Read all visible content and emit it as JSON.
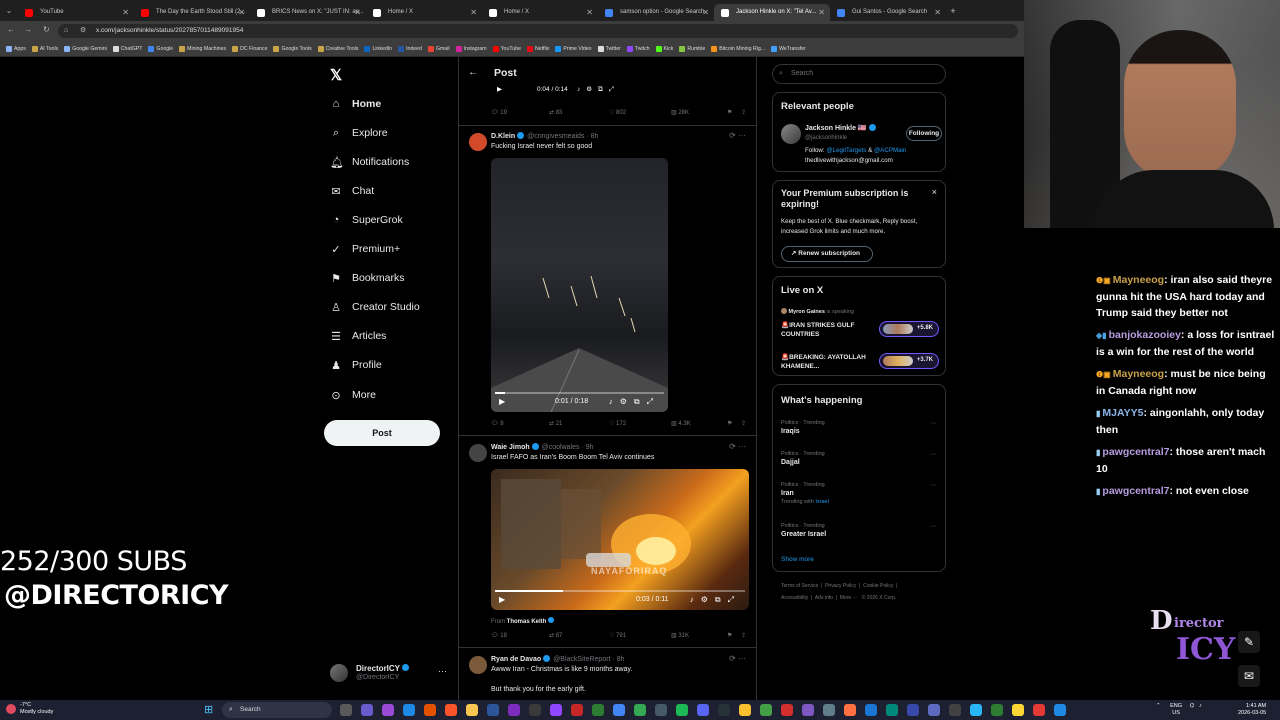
{
  "browser": {
    "tabs": [
      {
        "label": "YouTube",
        "color": "#ff0000"
      },
      {
        "label": "The Day the Earth Stood Still (2...",
        "color": "#ff0000"
      },
      {
        "label": "BRICS News on X: \"JUST IN: ac...",
        "color": "#ffffff"
      },
      {
        "label": "Home / X",
        "color": "#ffffff"
      },
      {
        "label": "Home / X",
        "color": "#ffffff"
      },
      {
        "label": "samson option - Google Search",
        "color": "#4285f4"
      },
      {
        "label": "Jackson Hinkle on X: \"Tel Av...",
        "color": "#ffffff",
        "active": true
      },
      {
        "label": "Gui Santos - Google Search",
        "color": "#4285f4"
      }
    ],
    "url": "x.com/jacksonhinkle/status/2027857011489091954",
    "bookmarks": [
      "Apps",
      "AI Tools",
      "Google Gemini",
      "ChatGPT",
      "Google",
      "Mining Machines",
      "DC Finance",
      "Google Tools",
      "Creative Tools",
      "LinkedIn",
      "Indeed",
      "Gmail",
      "Instagram",
      "YouTube",
      "Netflix",
      "Prime Video",
      "Twitter",
      "Twitch",
      "Kick",
      "Rumble",
      "Bitcoin Mining Rig...",
      "WeTransfer"
    ]
  },
  "nav": {
    "logo": "𝕏",
    "items": [
      {
        "label": "Home",
        "icon": "⌂",
        "name": "home-icon"
      },
      {
        "label": "Explore",
        "icon": "⌕",
        "name": "search-icon"
      },
      {
        "label": "Notifications",
        "icon": "🔔︎",
        "name": "bell-icon"
      },
      {
        "label": "Chat",
        "icon": "✉",
        "name": "mail-icon"
      },
      {
        "label": "SuperGrok",
        "icon": "◔",
        "name": "grok-icon"
      },
      {
        "label": "Premium+",
        "icon": "✓",
        "name": "premium-icon"
      },
      {
        "label": "Bookmarks",
        "icon": "⚑",
        "name": "bookmark-icon"
      },
      {
        "label": "Creator Studio",
        "icon": "♙",
        "name": "creator-icon"
      },
      {
        "label": "Articles",
        "icon": "☰",
        "name": "articles-icon"
      },
      {
        "label": "Profile",
        "icon": "♟",
        "name": "profile-icon"
      },
      {
        "label": "More",
        "icon": "⊙",
        "name": "more-icon"
      }
    ],
    "post_button": "Post",
    "account": {
      "name": "DirectorICY",
      "handle": "@DirectorICY",
      "more": "···"
    }
  },
  "post": {
    "back": "←",
    "title": "Post",
    "top_video": {
      "time": "0:04 / 0:14",
      "replies": "19",
      "reposts": "83",
      "likes": "802",
      "views": "28K"
    },
    "tweets": [
      {
        "name": "D.Klein",
        "handle": "@cnngivesmeaids · 8h",
        "text": "Fucking Israel never felt so good",
        "video_time": "0:01 / 0:18",
        "progress": 0.06,
        "replies": "8",
        "reposts": "21",
        "likes": "172",
        "views": "4.3K",
        "avatar": "#d24a2a"
      },
      {
        "name": "Waie Jimoh",
        "handle": "@coolwales · 9h",
        "text": "Israel FAFO as Iran's Boom Boom Tel Aviv continues",
        "video_time": "0:03 / 0:11",
        "progress": 0.27,
        "from_label": "From",
        "from_name": "Thomas Keith",
        "replies": "18",
        "reposts": "87",
        "likes": "791",
        "views": "31K",
        "avatar": "#444444"
      },
      {
        "name": "Ryan de Davao",
        "handle": "@BlackSiteReport · 8h",
        "text": "Awww Iran - Christmas is like 9 months away.",
        "text2": "But thank you for the early gift.",
        "avatar": "#7a5a3a"
      }
    ]
  },
  "right": {
    "search_placeholder": "Search",
    "relevant": {
      "title": "Relevant people",
      "name": "Jackson Hinkle 🇺🇸",
      "handle": "@jacksonhinkle",
      "follow_button": "Following",
      "bio_prefix": "Follow:",
      "bio_link1": "@LegitTargets",
      "bio_amp": "&",
      "bio_link2": "@ACPMain",
      "bio_email": "thedlivewithjackson@gmail.com"
    },
    "premium": {
      "title": "Your Premium subscription is expiring!",
      "body": "Keep the best of X. Blue checkmark, Reply boost, increased Grok limits and much more.",
      "button": "Renew subscription",
      "close": "×"
    },
    "live": {
      "title": "Live on X",
      "host": "Myron Gaines",
      "host_suffix": "is speaking",
      "items": [
        {
          "title": "🚨IRAN STRIKES GULF COUNTRIES",
          "count": "+5.8K"
        },
        {
          "title": "🚨BREAKING: AYATOLLAH KHAMENE...",
          "count": "+3.7K"
        }
      ]
    },
    "happening": {
      "title": "What's happening",
      "trends": [
        {
          "category": "Politics · Trending",
          "name": "Iraqis",
          "sub": ""
        },
        {
          "category": "Politics · Trending",
          "name": "Dajjal",
          "sub": ""
        },
        {
          "category": "Politics · Trending",
          "name": "Iran",
          "sub_prefix": "Trending with",
          "sub_link": "Israel"
        },
        {
          "category": "Politics · Trending",
          "name": "Greater Israel",
          "sub": ""
        }
      ],
      "show_more": "Show more"
    },
    "footer": [
      "Terms of Service",
      "Privacy Policy",
      "Cookie Policy",
      "Accessibility",
      "Ads info",
      "More ···",
      "© 2026 X Corp."
    ]
  },
  "overlay": {
    "subs": "252/300 SUBS",
    "handle": "@DIRECTORICY",
    "logo_d": "D",
    "logo_top": "irector",
    "logo_bottom": "ICY",
    "chat": [
      {
        "badges": "❶▣",
        "user": "Mayneeog",
        "color": "gold",
        "text": ": iran also said theyre gunna hit the USA hard today and Trump said they better not"
      },
      {
        "badges": "◈▮",
        "user": "banjokazooiey",
        "color": "purple",
        "text": ": a loss for isntrael is a win for the rest of the world"
      },
      {
        "badges": "❶▣",
        "user": "Mayneeog",
        "color": "gold",
        "text": ": must be nice being in Canada right now"
      },
      {
        "badges": "▮",
        "user": "MJAYY5",
        "color": "blue",
        "text": ": aingonlahh, only today then"
      },
      {
        "badges": "▮",
        "user": "pawgcentral7",
        "color": "purple",
        "text": ": those aren't mach 10"
      },
      {
        "badges": "▮",
        "user": "pawgcentral7",
        "color": "purple",
        "text": ": not even close"
      }
    ]
  },
  "taskbar": {
    "weather_temp": "-7°C",
    "weather_desc": "Mostly cloudy",
    "search": "Search",
    "lang": "ENG",
    "region": "US",
    "time": "1:41 AM",
    "date": "2026-03-05"
  }
}
